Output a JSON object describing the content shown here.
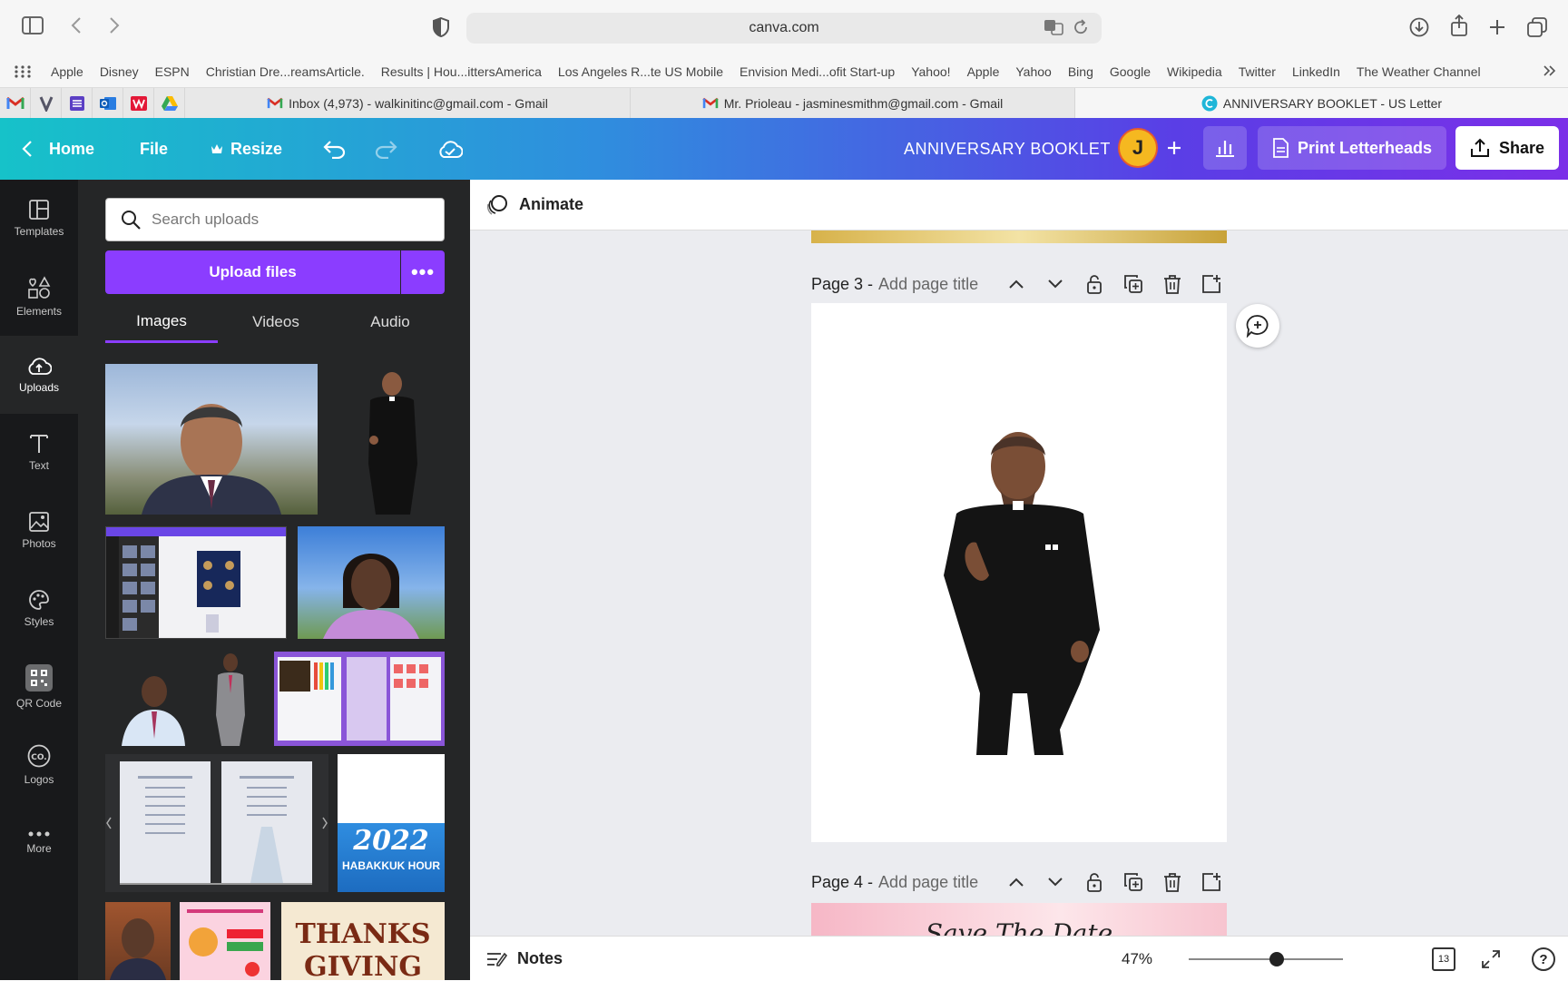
{
  "browser": {
    "url": "canva.com",
    "bookmarks": [
      "Apple",
      "Disney",
      "ESPN",
      "Christian Dre...reamsArticle.",
      "Results | Hou...ittersAmerica",
      "Los Angeles R...te US Mobile",
      "Envision Medi...ofit Start-up",
      "Yahoo!",
      "Apple",
      "Yahoo",
      "Bing",
      "Google",
      "Wikipedia",
      "Twitter",
      "LinkedIn",
      "The Weather Channel"
    ],
    "tabs": [
      {
        "label": "Inbox (4,973) - walkinitinc@gmail.com - Gmail"
      },
      {
        "label": "Mr. Prioleau - jasminesmithm@gmail.com - Gmail"
      },
      {
        "label": "ANNIVERSARY BOOKLET - US Letter"
      }
    ]
  },
  "header": {
    "home": "Home",
    "file": "File",
    "resize": "Resize",
    "title": "ANNIVERSARY BOOKLET",
    "avatar_initial": "J",
    "print": "Print Letterheads",
    "share": "Share"
  },
  "rail": [
    {
      "label": "Templates",
      "icon": "templates-icon"
    },
    {
      "label": "Elements",
      "icon": "elements-icon"
    },
    {
      "label": "Uploads",
      "icon": "uploads-icon"
    },
    {
      "label": "Text",
      "icon": "text-icon"
    },
    {
      "label": "Photos",
      "icon": "photos-icon"
    },
    {
      "label": "Styles",
      "icon": "styles-icon"
    },
    {
      "label": "QR Code",
      "icon": "qr-code-icon"
    },
    {
      "label": "Logos",
      "icon": "logos-icon"
    },
    {
      "label": "More",
      "icon": "more-icon"
    }
  ],
  "panel": {
    "search_placeholder": "Search uploads",
    "upload_label": "Upload files",
    "more_label": "•••",
    "tabs": [
      "Images",
      "Videos",
      "Audio"
    ],
    "thumb_texts": {
      "year": "2022",
      "habakkuk": "HABAKKUK HOUR",
      "thanks": "THANKS",
      "giving": "GIVING"
    }
  },
  "editor": {
    "animate": "Animate",
    "page3_label": "Page 3 -",
    "page4_label": "Page 4 -",
    "title_placeholder": "Add page title",
    "page4_preview": "Save The Date"
  },
  "bottom": {
    "notes": "Notes",
    "zoom": "47%",
    "zoom_level": 0.47,
    "pages": "13"
  },
  "colors": {
    "accent": "#8b3dff",
    "header_start": "#16c2c9",
    "header_end": "#7b2fe8"
  }
}
